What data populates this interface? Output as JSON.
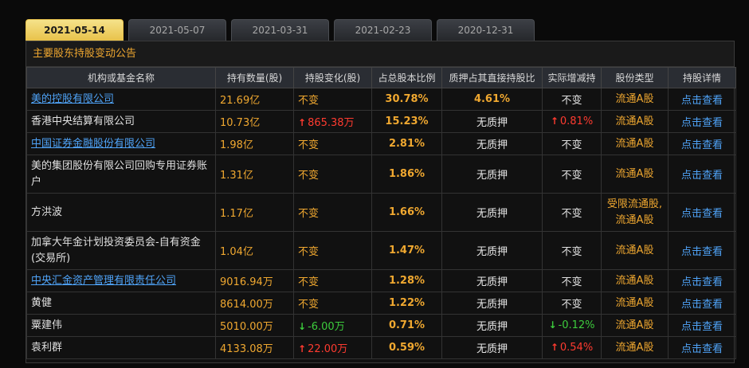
{
  "tabs": [
    "2021-05-14",
    "2021-05-07",
    "2021-03-31",
    "2021-02-23",
    "2020-12-31"
  ],
  "active_tab": 0,
  "panel_title": "主要股东持股变动公告",
  "columns": [
    "机构或基金名称",
    "持有数量(股)",
    "持股变化(股)",
    "占总股本比例",
    "质押占其直接持股比",
    "实际增减持",
    "股份类型",
    "持股详情"
  ],
  "rows": [
    {
      "name": "美的控股有限公司",
      "link": true,
      "shares": "21.69亿",
      "change": "不变",
      "change_dir": "",
      "ratio": "30.78%",
      "pledge": "4.61%",
      "actual": "不变",
      "actual_dir": "",
      "type": "流通A股",
      "detail": "点击查看"
    },
    {
      "name": "香港中央结算有限公司",
      "link": false,
      "shares": "10.73亿",
      "change": "865.38万",
      "change_dir": "up",
      "ratio": "15.23%",
      "pledge": "无质押",
      "actual": "0.81%",
      "actual_dir": "up",
      "type": "流通A股",
      "detail": "点击查看"
    },
    {
      "name": "中国证券金融股份有限公司",
      "link": true,
      "shares": "1.98亿",
      "change": "不变",
      "change_dir": "",
      "ratio": "2.81%",
      "pledge": "无质押",
      "actual": "不变",
      "actual_dir": "",
      "type": "流通A股",
      "detail": "点击查看"
    },
    {
      "name": "美的集团股份有限公司回购专用证券账户",
      "link": false,
      "shares": "1.31亿",
      "change": "不变",
      "change_dir": "",
      "ratio": "1.86%",
      "pledge": "无质押",
      "actual": "不变",
      "actual_dir": "",
      "type": "流通A股",
      "detail": "点击查看"
    },
    {
      "name": "方洪波",
      "link": false,
      "shares": "1.17亿",
      "change": "不变",
      "change_dir": "",
      "ratio": "1.66%",
      "pledge": "无质押",
      "actual": "不变",
      "actual_dir": "",
      "type": "受限流通股,流通A股",
      "detail": "点击查看"
    },
    {
      "name": "加拿大年金计划投资委员会-自有资金(交易所)",
      "link": false,
      "shares": "1.04亿",
      "change": "不变",
      "change_dir": "",
      "ratio": "1.47%",
      "pledge": "无质押",
      "actual": "不变",
      "actual_dir": "",
      "type": "流通A股",
      "detail": "点击查看"
    },
    {
      "name": "中央汇金资产管理有限责任公司",
      "link": true,
      "shares": "9016.94万",
      "change": "不变",
      "change_dir": "",
      "ratio": "1.28%",
      "pledge": "无质押",
      "actual": "不变",
      "actual_dir": "",
      "type": "流通A股",
      "detail": "点击查看"
    },
    {
      "name": "黄健",
      "link": false,
      "shares": "8614.00万",
      "change": "不变",
      "change_dir": "",
      "ratio": "1.22%",
      "pledge": "无质押",
      "actual": "不变",
      "actual_dir": "",
      "type": "流通A股",
      "detail": "点击查看"
    },
    {
      "name": "粟建伟",
      "link": false,
      "shares": "5010.00万",
      "change": "-6.00万",
      "change_dir": "down",
      "ratio": "0.71%",
      "pledge": "无质押",
      "actual": "-0.12%",
      "actual_dir": "down",
      "type": "流通A股",
      "detail": "点击查看"
    },
    {
      "name": "袁利群",
      "link": false,
      "shares": "4133.08万",
      "change": "22.00万",
      "change_dir": "up",
      "ratio": "0.59%",
      "pledge": "无质押",
      "actual": "0.54%",
      "actual_dir": "up",
      "type": "流通A股",
      "detail": "点击查看"
    }
  ],
  "colors": {
    "accent": "#f0a830",
    "link": "#4fa3f7",
    "up": "#ff3b30",
    "down": "#3dcc3d",
    "active_tab": "#e8c24a"
  }
}
